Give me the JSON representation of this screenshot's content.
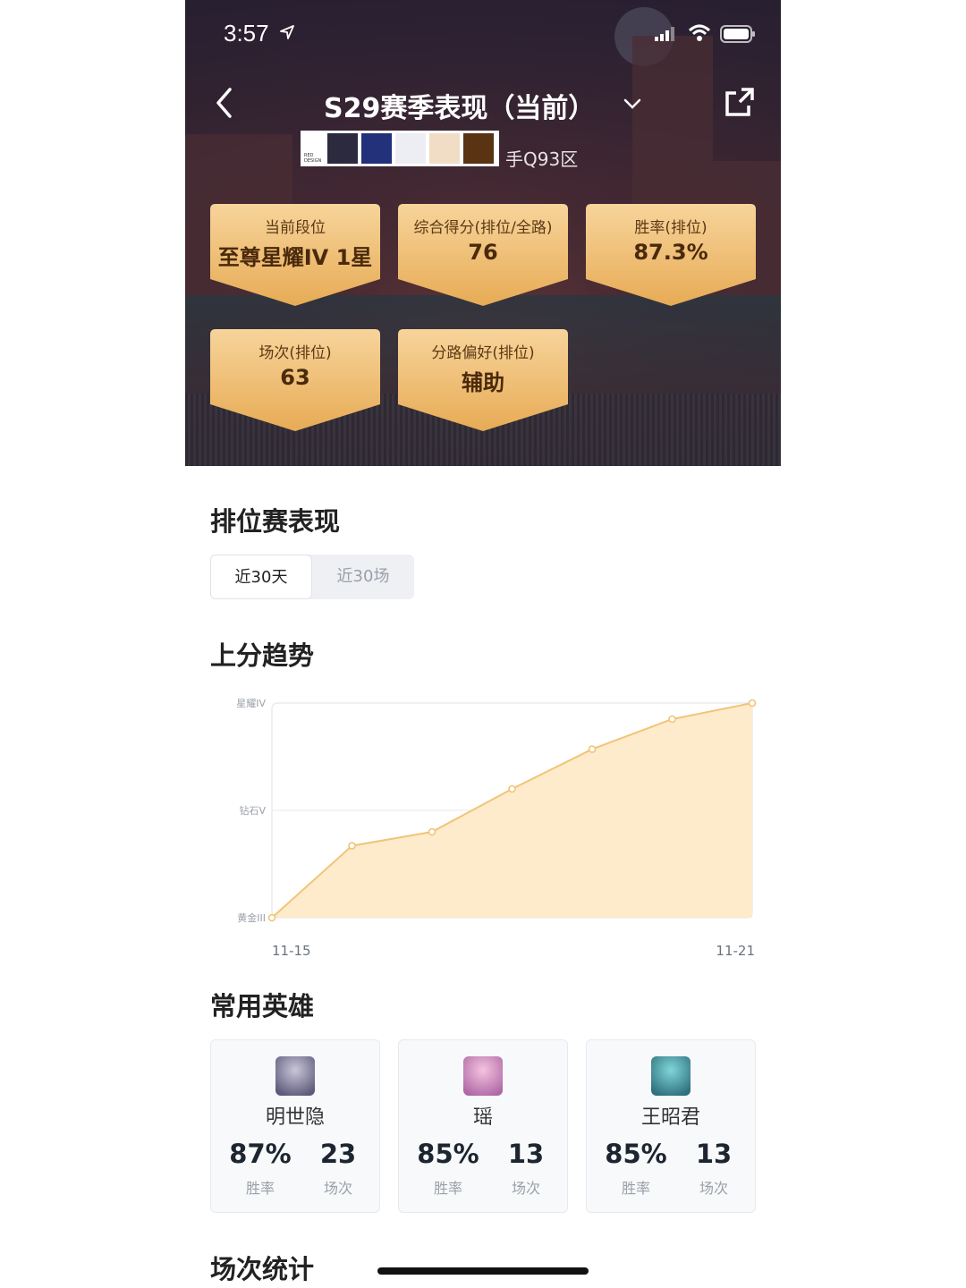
{
  "status_bar": {
    "time": "3:57"
  },
  "header": {
    "title": "S29赛季表现（当前）",
    "server": "手Q93区",
    "swatch_logo": "RED DESIGN",
    "swatch_colors": [
      "#2b2a3f",
      "#23307a",
      "#eceef3",
      "#f1dcc6",
      "#5a3313"
    ]
  },
  "stat_cards": [
    {
      "label": "当前段位",
      "value": "至尊星耀IV 1星"
    },
    {
      "label": "综合得分(排位/全路)",
      "value": "76"
    },
    {
      "label": "胜率(排位)",
      "value": "87.3%"
    },
    {
      "label": "场次(排位)",
      "value": "63"
    },
    {
      "label": "分路偏好(排位)",
      "value": "辅助"
    }
  ],
  "ranked": {
    "title": "排位赛表现",
    "tabs": [
      {
        "label": "近30天",
        "active": true
      },
      {
        "label": "近30场",
        "active": false
      }
    ]
  },
  "trend": {
    "title": "上分趋势"
  },
  "chart_data": {
    "type": "area",
    "y_levels": [
      "黄金III",
      "钻石V",
      "星耀IV"
    ],
    "x_start_label": "11-15",
    "x_end_label": "11-21",
    "values": [
      0,
      0.67,
      0.8,
      1.2,
      1.57,
      1.85,
      2.0
    ],
    "ylim": [
      0,
      2
    ],
    "grid": true,
    "colors": {
      "line": "#f2c477",
      "fill": "#fde9c6"
    }
  },
  "heroes": {
    "title": "常用英雄",
    "win_label": "胜率",
    "games_label": "场次",
    "items": [
      {
        "name": "明世隐",
        "win_rate": "87%",
        "games": "23",
        "avatar_colors": [
          "#c9c6d8",
          "#5d5a7a"
        ]
      },
      {
        "name": "瑶",
        "win_rate": "85%",
        "games": "13",
        "avatar_colors": [
          "#f4c3df",
          "#b069a6"
        ]
      },
      {
        "name": "王昭君",
        "win_rate": "85%",
        "games": "13",
        "avatar_colors": [
          "#7fd7d8",
          "#2f6f7e"
        ]
      }
    ]
  },
  "match_stats": {
    "title": "场次统计"
  }
}
